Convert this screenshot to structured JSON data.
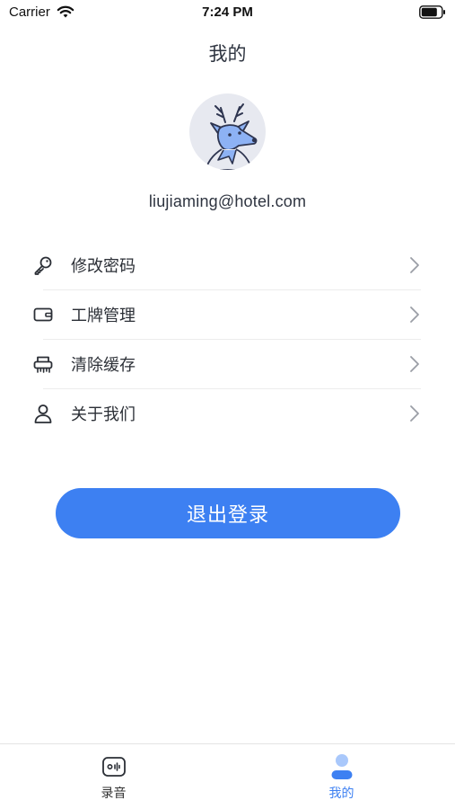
{
  "status_bar": {
    "carrier": "Carrier",
    "time": "7:24 PM"
  },
  "header": {
    "title": "我的"
  },
  "profile": {
    "email": "liujiaming@hotel.com",
    "avatar_icon": "deer-avatar-icon"
  },
  "menu": {
    "items": [
      {
        "label": "修改密码",
        "icon": "key-icon"
      },
      {
        "label": "工牌管理",
        "icon": "badge-card-icon"
      },
      {
        "label": "清除缓存",
        "icon": "shredder-icon"
      },
      {
        "label": "关于我们",
        "icon": "person-icon"
      }
    ]
  },
  "logout": {
    "label": "退出登录"
  },
  "tab_bar": {
    "tabs": [
      {
        "label": "录音",
        "icon": "record-icon",
        "active": false
      },
      {
        "label": "我的",
        "icon": "profile-icon",
        "active": true
      }
    ]
  },
  "colors": {
    "accent": "#3d80f2",
    "text": "#2b2f36",
    "divider": "#ececec",
    "avatar_bg": "#e7e9f0"
  }
}
